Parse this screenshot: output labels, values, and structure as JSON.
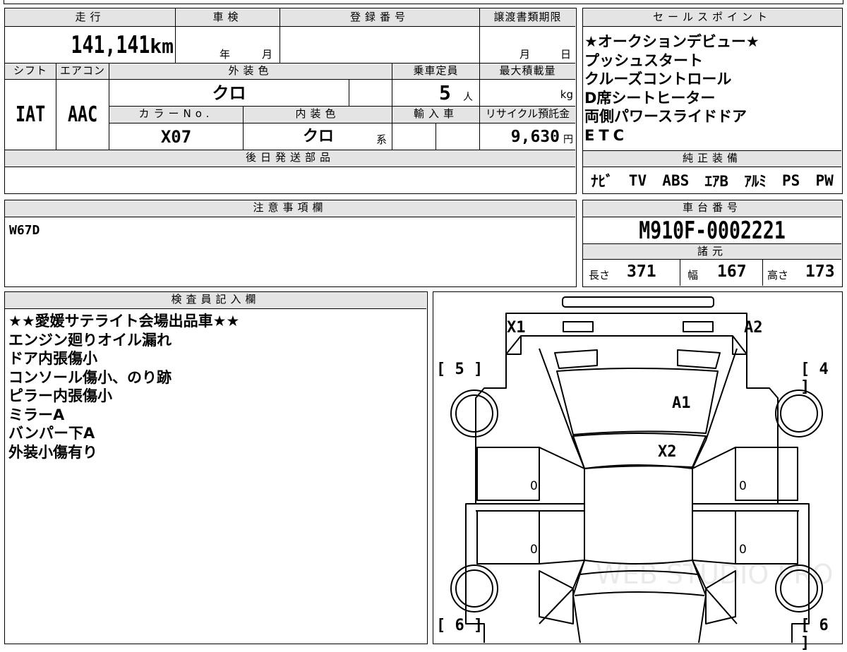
{
  "sheet": {
    "header_top": "",
    "mileage": {
      "label": "走行",
      "value": "141,141",
      "unit": "km"
    },
    "shaken": {
      "label": "車検",
      "year_unit": "年",
      "month_unit": "月"
    },
    "registration": {
      "label": "登録番号",
      "value": ""
    },
    "transfer_deadline": {
      "label": "譲渡書類期限",
      "month_unit": "月",
      "day_unit": "日"
    },
    "shift": {
      "label": "シフト",
      "value": "IAT"
    },
    "aircon": {
      "label": "エアコン",
      "value": "AAC"
    },
    "exterior_color": {
      "label": "外装色",
      "value": "クロ"
    },
    "capacity": {
      "label": "乗車定員",
      "value": "5",
      "unit": "人"
    },
    "max_load": {
      "label": "最大積載量",
      "unit": "kg"
    },
    "color_no": {
      "label": "カラーNo.",
      "value": "X07"
    },
    "interior_color": {
      "label": "内装色",
      "value": "クロ",
      "suffix": "系"
    },
    "import": {
      "label": "輸入車"
    },
    "recycle_fee": {
      "label": "リサイクル預託金",
      "value": "9,630",
      "unit": "円"
    },
    "later_shipping": {
      "label": "後日発送部品",
      "value": ""
    },
    "sales_points": {
      "label": "セールスポイント",
      "items": [
        "★オークションデビュー★",
        "プッシュスタート",
        "クルーズコントロール",
        "D席シートヒーター",
        "両側パワースライドドア",
        "ETC"
      ]
    },
    "genuine_equipment": {
      "label": "純正装備",
      "items": [
        "ﾅﾋﾞ",
        "TV",
        "ABS",
        "ｴｱB",
        "ｱﾙﾐ",
        "PS",
        "PW"
      ]
    },
    "notes": {
      "label": "注意事項欄",
      "value": "W67D"
    },
    "chassis": {
      "label": "車台番号",
      "value": "M910F-0002221"
    },
    "specs": {
      "label": "諸元",
      "length_label": "長さ",
      "length": "371",
      "width_label": "幅",
      "width": "167",
      "height_label": "高さ",
      "height": "173"
    },
    "inspector": {
      "label": "検査員記入欄",
      "lines": [
        "★★愛媛サテライト会場出品車★★",
        "エンジン廻りオイル漏れ",
        "ドア内張傷小",
        "コンソール傷小、のり跡",
        "ピラー内張傷小",
        "ミラーA",
        "バンパー下A",
        "外装小傷有り"
      ]
    },
    "diagram": {
      "marks": {
        "x1": "X1",
        "a2": "A2",
        "a1": "A1",
        "x2": "X2"
      },
      "tires": {
        "front_left": "5",
        "front_right": "4",
        "rear_left": "6",
        "rear_right": "6"
      },
      "door_zeros": [
        "0",
        "0",
        "0",
        "0"
      ],
      "watermark": "WEB STUDIO PRO"
    }
  }
}
